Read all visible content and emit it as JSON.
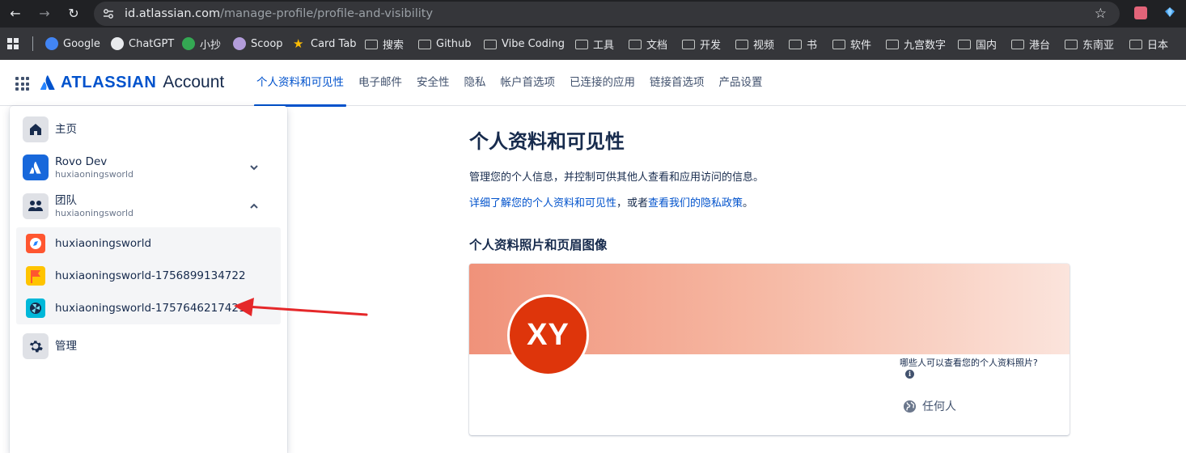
{
  "browser": {
    "url_host": "id.atlassian.com",
    "url_path": "/manage-profile/profile-and-visibility"
  },
  "bookmarks": [
    {
      "label": "Google",
      "icon": "google-icon"
    },
    {
      "label": "ChatGPT",
      "icon": "chatgpt-icon"
    },
    {
      "label": "小抄",
      "icon": "xiaochao-icon"
    },
    {
      "label": "Scoop",
      "icon": "scoop-icon"
    },
    {
      "label": "Card Tab",
      "icon": "star-icon"
    },
    {
      "label": "搜索",
      "icon": "folder-icon"
    },
    {
      "label": "Github",
      "icon": "folder-icon"
    },
    {
      "label": "Vibe Coding",
      "icon": "folder-icon"
    },
    {
      "label": "工具",
      "icon": "folder-icon"
    },
    {
      "label": "文档",
      "icon": "folder-icon"
    },
    {
      "label": "开发",
      "icon": "folder-icon"
    },
    {
      "label": "视频",
      "icon": "folder-icon"
    },
    {
      "label": "书",
      "icon": "folder-icon"
    },
    {
      "label": "软件",
      "icon": "folder-icon"
    },
    {
      "label": "九宫数字",
      "icon": "folder-icon"
    },
    {
      "label": "国内",
      "icon": "folder-icon"
    },
    {
      "label": "港台",
      "icon": "folder-icon"
    },
    {
      "label": "东南亚",
      "icon": "folder-icon"
    },
    {
      "label": "日本",
      "icon": "folder-icon"
    }
  ],
  "header": {
    "logo_word": "ATLASSIAN",
    "logo_account": "Account",
    "tabs": [
      {
        "label": "个人资料和可见性",
        "active": true
      },
      {
        "label": "电子邮件",
        "active": false
      },
      {
        "label": "安全性",
        "active": false
      },
      {
        "label": "隐私",
        "active": false
      },
      {
        "label": "帐户首选项",
        "active": false
      },
      {
        "label": "已连接的应用",
        "active": false
      },
      {
        "label": "链接首选项",
        "active": false
      },
      {
        "label": "产品设置",
        "active": false
      }
    ]
  },
  "menu": {
    "home": {
      "label": "主页",
      "icon": "home-icon"
    },
    "rovo": {
      "title": "Rovo Dev",
      "subtitle": "huxiaoningsworld",
      "icon": "atlassian-icon",
      "expanded": false
    },
    "teams": {
      "title": "团队",
      "subtitle": "huxiaoningsworld",
      "icon": "people-icon",
      "expanded": true
    },
    "team_items": [
      {
        "name": "huxiaoningsworld",
        "icon": "compass-avatar-icon"
      },
      {
        "name": "huxiaoningsworld-1756899134722",
        "icon": "flag-avatar-icon"
      },
      {
        "name": "huxiaoningsworld-1757646217421",
        "icon": "fan-avatar-icon"
      }
    ],
    "admin": {
      "label": "管理",
      "icon": "gear-icon"
    }
  },
  "main": {
    "title": "个人资料和可见性",
    "description": "管理您的个人信息，并控制可供其他人查看和应用访问的信息。",
    "link_learn": "详细了解您的个人资料和可见性",
    "link_sep": "，或者",
    "link_privacy": "查看我们的隐私政策",
    "link_end": "。",
    "section_title": "个人资料照片和页眉图像",
    "avatar_initials": "XY",
    "visibility_question": "哪些人可以查看您的个人资料照片?",
    "visibility_value": "任何人"
  },
  "colors": {
    "accent": "#0052cc",
    "avatar_bg": "#de350b",
    "annotation_arrow": "#e5282a"
  }
}
